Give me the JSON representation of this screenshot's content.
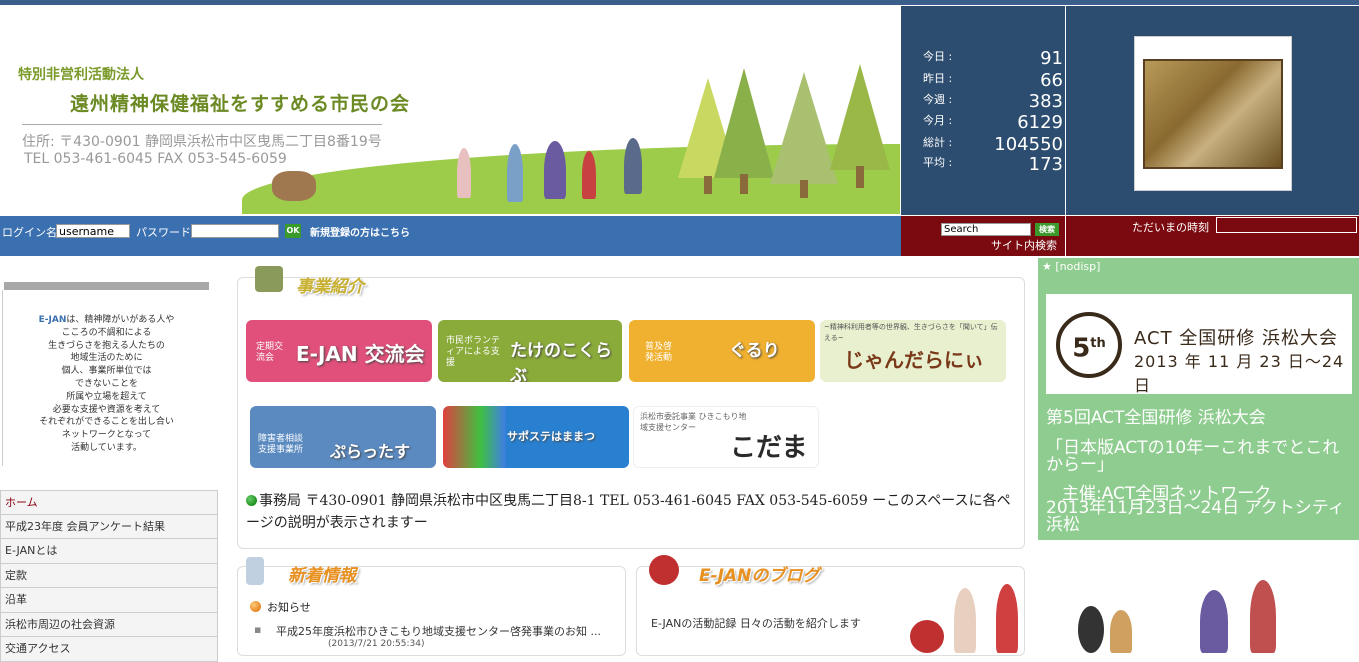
{
  "header": {
    "org_type": "特別非営利活動法人",
    "org_name": "遠州精神保健福祉をすすめる市民の会",
    "address": "住所: 〒430-0901 静岡県浜松市中区曳馬二丁目8番19号",
    "tel_fax": "TEL 053-461-6045  FAX 053-545-6059"
  },
  "counter": [
    {
      "label": "今日 :",
      "value": "91"
    },
    {
      "label": "昨日 :",
      "value": "66"
    },
    {
      "label": "今週 :",
      "value": "383"
    },
    {
      "label": "今月 :",
      "value": "6129"
    },
    {
      "label": "総計 :",
      "value": "104550"
    },
    {
      "label": "平均 :",
      "value": "173"
    }
  ],
  "login": {
    "login_label": "ログイン名",
    "username_value": "username",
    "password_label": "パスワード",
    "password_value": "",
    "ok_label": "OK",
    "register_link": "新規登録の方はこちら"
  },
  "search": {
    "value": "Search",
    "button_label": "検索",
    "site_search_label": "サイト内検索"
  },
  "clock": {
    "label": "ただいまの時刻",
    "value": ""
  },
  "mission": {
    "lead": "E-JAN",
    "lines": [
      "は、精神障がいがある人や",
      "こころの不調和による",
      "生きづらさを抱える人たちの",
      "地域生活のために",
      "個人、事業所単位では",
      "できないことを",
      "所属や立場を超えて",
      "必要な支援や資源を考えて",
      "それぞれができることを出し合い",
      "ネットワークとなって",
      "活動しています。"
    ]
  },
  "nav": [
    "ホーム",
    "平成23年度 会員アンケート結果",
    "E-JANとは",
    "定款",
    "沿革",
    "浜松市周辺の社会資源",
    "交通アクセス"
  ],
  "business": {
    "heading": "事業紹介",
    "cards": [
      {
        "title": "E-JAN 交流会",
        "sub": "定期交流会",
        "color": "#e0507a"
      },
      {
        "title": "たけのこくらぶ",
        "sub": "市民ボランティアによる支援",
        "color": "#8aaa3a"
      },
      {
        "title": "ぐるり",
        "sub": "普及啓発活動",
        "color": "#f0b030"
      },
      {
        "title": "じゃんだらにぃ",
        "sub": "~精神科利用者等の世界観、生きづらさを「聞いて」伝える~",
        "color": "#e8f0d0"
      },
      {
        "title": "ぷらったす",
        "sub": "障害者相談支援事業所",
        "color": "#5a8ac0"
      },
      {
        "title": "サポステはままつ",
        "sub": "",
        "color": "#2a80d0"
      },
      {
        "title": "こだま",
        "sub": "浜松市委託事業 ひきこもり地域支援センター",
        "color": "#ffffff"
      }
    ],
    "contact": "事務局 〒430-0901 静岡県浜松市中区曳馬二丁目8-1 TEL 053-461-6045  FAX 053-545-6059 ーこのスペースに各ページの説明が表示されますー"
  },
  "news": {
    "heading": "新着情報",
    "category": "お知らせ",
    "item": "平成25年度浜松市ひきこもり地域支援センター啓発事業のお知 ...",
    "item_date": "(2013/7/21 20:55:34)"
  },
  "blog": {
    "heading": "E-JANのブログ",
    "desc": "E-JANの活動記録 日々の活動を紹介します"
  },
  "event": {
    "nodisp": "★ [nodisp]",
    "badge_num": "5",
    "badge_sup": "th",
    "banner_title": "ACT 全国研修 浜松大会",
    "banner_date": "2013 年 11 月 23 日〜24 日",
    "title": "第5回ACT全国研修 浜松大会",
    "subtitle": "「日本版ACTの10年ーこれまでとこれからー」",
    "organizer": "主催:ACT全国ネットワーク",
    "date_place": "2013年11月23日〜24日 アクトシティ浜松"
  }
}
